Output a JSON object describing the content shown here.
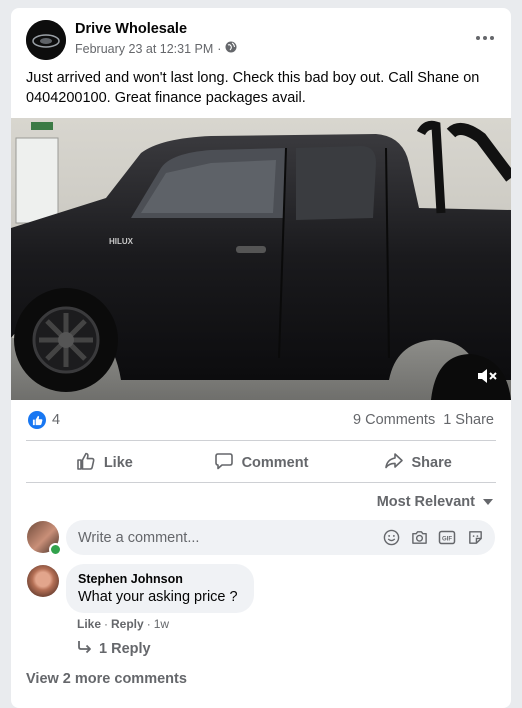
{
  "post": {
    "page_name": "Drive Wholesale",
    "timestamp": "February 23 at 12:31 PM",
    "separator": "·",
    "privacy_icon": "globe-icon",
    "text": "Just arrived and won't last long. Check this bad boy out. Call Shane on 0404200100. Great finance packages avail.",
    "photo_badge": "HILUX"
  },
  "engagement": {
    "reaction_count": "4",
    "comments": "9 Comments",
    "shares": "1 Share"
  },
  "actions": {
    "like": "Like",
    "comment": "Comment",
    "share": "Share"
  },
  "sort": {
    "label": "Most Relevant"
  },
  "composer": {
    "placeholder": "Write a comment..."
  },
  "comments": [
    {
      "author": "Stephen Johnson",
      "text": "What your asking price ?",
      "like": "Like",
      "reply": "Reply",
      "age": "1w",
      "replies": "1 Reply"
    }
  ],
  "view_more": "View 2 more comments",
  "colors": {
    "facebook_blue": "#1877f2",
    "secondary_text": "#65676b",
    "online_green": "#31a24c"
  }
}
